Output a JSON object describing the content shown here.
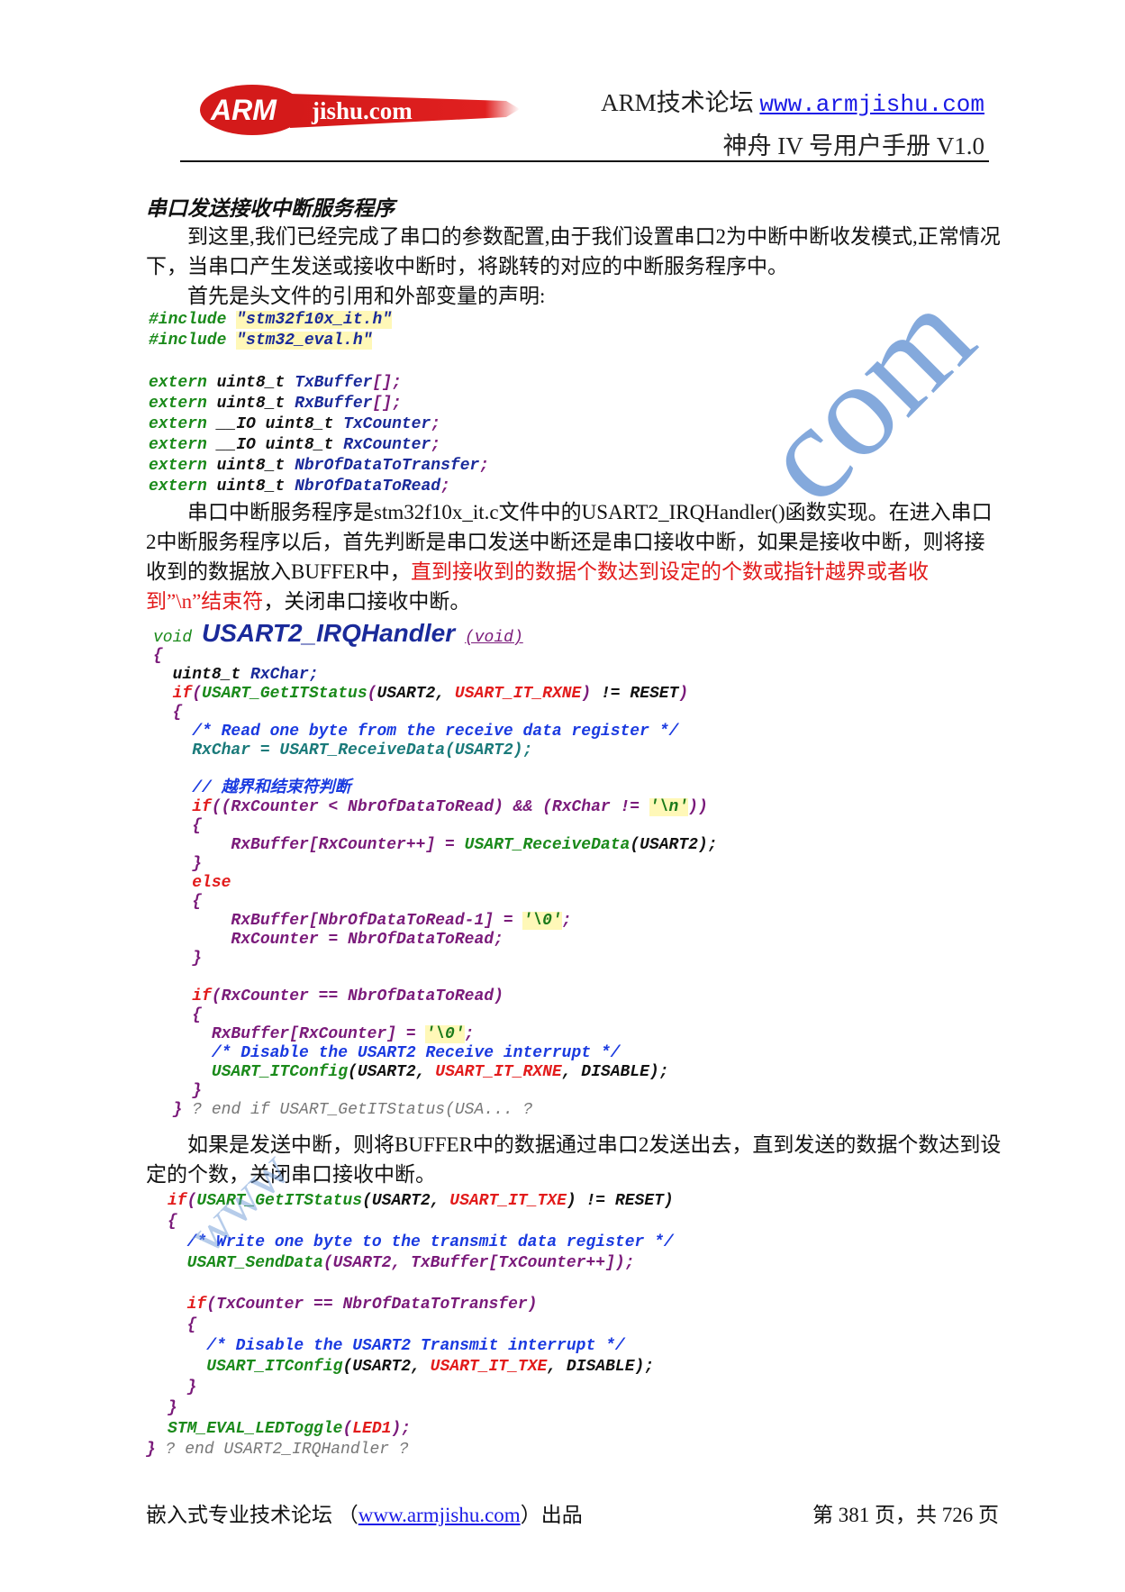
{
  "header": {
    "logo_text_left": "ARM",
    "logo_text_right": "jishu.com",
    "forum_label": "ARM技术论坛",
    "forum_url": "www.armjishu.com",
    "manual_title": "神舟 IV 号用户手册  V1.0"
  },
  "section": {
    "title": "串口发送接收中断服务程序",
    "para1": "到这里,我们已经完成了串口的参数配置,由于我们设置串口2为中断中断收发模式,正常情况下，当串口产生发送或接收中断时，将跳转的对应的中断服务程序中。",
    "para2": "首先是头文件的引用和外部变量的声明:",
    "para3_black": "串口中断服务程序是stm32f10x_it.c文件中的USART2_IRQHandler()函数实现。在进入串口2中断服务程序以后，首先判断是串口发送中断还是串口接收中断，如果是接收中断，则将接收到的数据放入BUFFER中，",
    "para3_red": "直到接收到的数据个数达到设定的个数或指针越界或者收到”\\n”结束符",
    "para3_end": "，关闭串口接收中断。",
    "para4": "如果是发送中断，则将BUFFER中的数据通过串口2发送出去，直到发送的数据个数达到设定的个数，关闭串口接收中断。"
  },
  "code_includes": {
    "kw": "#include",
    "file1": "\"stm32f10x_it.h\"",
    "file2": "\"stm32_eval.h\""
  },
  "code_externs": [
    {
      "kw": "extern",
      "type": "uint8_t",
      "name": "TxBuffer",
      "suffix": "[];"
    },
    {
      "kw": "extern",
      "type": "uint8_t",
      "name": "RxBuffer",
      "suffix": "[];"
    },
    {
      "kw": "extern",
      "type": "__IO uint8_t",
      "name": "TxCounter",
      "suffix": ";"
    },
    {
      "kw": "extern",
      "type": "__IO uint8_t",
      "name": "RxCounter",
      "suffix": ";"
    },
    {
      "kw": "extern",
      "type": "uint8_t",
      "name": "NbrOfDataToTransfer",
      "suffix": ";"
    },
    {
      "kw": "extern",
      "type": "uint8_t",
      "name": "NbrOfDataToRead",
      "suffix": ";"
    }
  ],
  "code_handler": {
    "void_kw": "void",
    "func_name": "USART2_IRQHandler",
    "params": "(void)",
    "lines": {
      "open": "{",
      "decl_type": "uint8_t",
      "decl_var": "RxChar;",
      "if1_kw": "if",
      "if1_fn": "USART_GetITStatus",
      "if1_arg1": "USART2,",
      "if1_arg2": "USART_IT_RXNE",
      "if1_tail": "!= RESET",
      "cmt_read": "/* Read one byte from the receive data register */",
      "rxchar_assign": "RxChar = USART_ReceiveData(USART2);",
      "cmt_cn": "// 越界和结束符判断",
      "if2_kw": "if",
      "if2_cond": "((RxCounter < NbrOfDataToRead) && (RxChar != ",
      "if2_chr": "'\\n'",
      "if2_end": "))",
      "rxbuf_var": "RxBuffer[RxCounter++] = ",
      "rxbuf_fn": "USART_ReceiveData",
      "rxbuf_arg": "(USART2);",
      "else_kw": "else",
      "rxbuf_last": "RxBuffer[NbrOfDataToRead-1] = ",
      "null_chr": "'\\0'",
      "rxcounter_set": "RxCounter = NbrOfDataToRead;",
      "if3_kw": "if",
      "if3_cond": "(RxCounter == NbrOfDataToRead)",
      "rxbuf_term": "RxBuffer[RxCounter] = ",
      "cmt_disable_rx": "/* Disable the USART2 Receive interrupt */",
      "itconfig_fn": "USART_ITConfig",
      "itconfig_arg1": "(USART2, ",
      "itconfig_rx": "USART_IT_RXNE",
      "itconfig_tail": ", DISABLE);",
      "close": "}",
      "end_if_comment": "? end if USART_GetITStatus(USA... ?"
    }
  },
  "code_tx": {
    "if_kw": "if",
    "if_fn": "USART_GetITStatus",
    "if_arg1": "(USART2, ",
    "if_arg2": "USART_IT_TXE",
    "if_tail": ") != RESET)",
    "cmt_write": "/* Write one byte to the transmit data register */",
    "send_fn": "USART_SendData",
    "send_args": "(USART2, TxBuffer[TxCounter++]);",
    "if2_kw": "if",
    "if2_cond": "(TxCounter == NbrOfDataToTransfer)",
    "cmt_disable_tx": "/* Disable the USART2 Transmit interrupt */",
    "itconfig_fn": "USART_ITConfig",
    "itconfig_arg1": "(USART2, ",
    "itconfig_tx": "USART_IT_TXE",
    "itconfig_tail": ", DISABLE);",
    "led_fn": "STM_EVAL_LEDToggle",
    "led_arg": "LED1",
    "end_comment": "? end USART2_IRQHandler ?"
  },
  "footer": {
    "left_prefix": "嵌入式专业技术论坛 （",
    "left_url": "www.armjishu.com",
    "left_suffix": "）出品",
    "page_info": "第 381 页，共 726 页"
  },
  "watermark": {
    "text1": "com",
    "text2": "www"
  }
}
